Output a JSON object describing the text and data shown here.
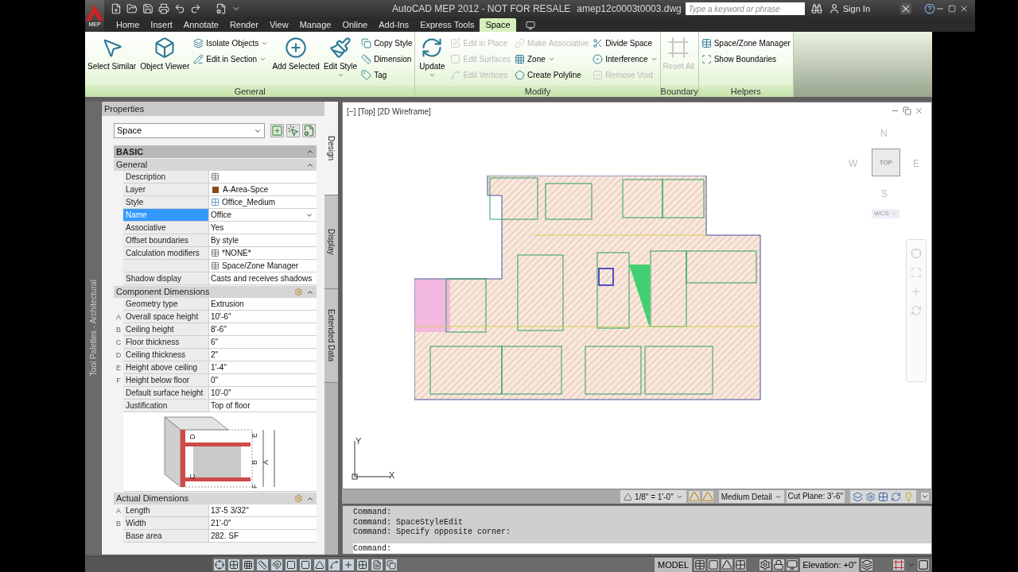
{
  "app_button": {
    "label": "MEP"
  },
  "title_bar": {
    "title": "AutoCAD MEP 2012 - NOT FOR RESALE",
    "filename": "amep12c0003t0003.dwg",
    "search_placeholder": "Type a keyword or phrase",
    "sign_in": "Sign In"
  },
  "ribbon_tabs": [
    {
      "label": "Home",
      "selected": false
    },
    {
      "label": "Insert",
      "selected": false
    },
    {
      "label": "Annotate",
      "selected": false
    },
    {
      "label": "Render",
      "selected": false
    },
    {
      "label": "View",
      "selected": false
    },
    {
      "label": "Manage",
      "selected": false
    },
    {
      "label": "Online",
      "selected": false
    },
    {
      "label": "Add-Ins",
      "selected": false
    },
    {
      "label": "Express Tools",
      "selected": false
    },
    {
      "label": "Space",
      "selected": true
    }
  ],
  "ribbon_panels": [
    {
      "title": "General",
      "groups": [
        {
          "kind": "large",
          "label": "Select Similar",
          "disabled": false,
          "dropdown": false
        },
        {
          "kind": "large",
          "label": "Object Viewer",
          "disabled": false,
          "dropdown": false
        },
        {
          "kind": "stack",
          "items": [
            {
              "label": "Isolate Objects",
              "disabled": false,
              "dropdown": true
            },
            {
              "label": "Edit in Section",
              "disabled": false,
              "dropdown": true
            }
          ]
        },
        {
          "kind": "large",
          "label": "Add Selected",
          "disabled": false,
          "dropdown": false
        },
        {
          "kind": "large",
          "label": "Edit Style",
          "disabled": false,
          "dropdown": true
        },
        {
          "kind": "stack",
          "items": [
            {
              "label": "Copy Style",
              "disabled": false,
              "dropdown": false
            },
            {
              "label": "Dimension",
              "disabled": false,
              "dropdown": false
            },
            {
              "label": "Tag",
              "disabled": false,
              "dropdown": false
            }
          ]
        }
      ]
    },
    {
      "title": "Modify",
      "groups": [
        {
          "kind": "large",
          "label": "Update",
          "disabled": false,
          "dropdown": true
        },
        {
          "kind": "stack",
          "items": [
            {
              "label": "Edit in Place",
              "disabled": true,
              "dropdown": false
            },
            {
              "label": "Edit Surfaces",
              "disabled": true,
              "dropdown": false
            },
            {
              "label": "Edit Vertices",
              "disabled": true,
              "dropdown": false
            }
          ]
        },
        {
          "kind": "stack",
          "items": [
            {
              "label": "Make Associative",
              "disabled": true,
              "dropdown": false
            },
            {
              "label": "Zone",
              "disabled": false,
              "dropdown": true
            },
            {
              "label": "Create Polyline",
              "disabled": false,
              "dropdown": false
            }
          ]
        },
        {
          "kind": "stack",
          "items": [
            {
              "label": "Divide Space",
              "disabled": false,
              "dropdown": false
            },
            {
              "label": "Interference",
              "disabled": false,
              "dropdown": true
            },
            {
              "label": "Remove Void",
              "disabled": true,
              "dropdown": false
            }
          ]
        }
      ]
    },
    {
      "title": "Boundary",
      "groups": [
        {
          "kind": "large",
          "label": "Reset All",
          "disabled": true,
          "dropdown": false
        }
      ]
    },
    {
      "title": "Helpers",
      "groups": [
        {
          "kind": "stack",
          "items": [
            {
              "label": "Space/Zone Manager",
              "disabled": false,
              "dropdown": false
            },
            {
              "label": "Show Boundaries",
              "disabled": false,
              "dropdown": false
            }
          ]
        }
      ]
    }
  ],
  "tool_palettes": {
    "label": "Tool Palettes - Architectural"
  },
  "properties": {
    "title": "Properties",
    "selector": "Space",
    "side_tabs": [
      {
        "label": "Design",
        "selected": true
      },
      {
        "label": "Display",
        "selected": false
      },
      {
        "label": "Extended Data",
        "selected": false
      }
    ],
    "sections": [
      {
        "title": "BASIC",
        "expanded": true,
        "categories": [
          {
            "title": "General",
            "expanded": true,
            "settings_button": false,
            "rows": [
              {
                "label": "Description",
                "kind": "icon",
                "selected": false
              },
              {
                "label": "Layer",
                "value": "A-Area-Spce",
                "kind": "swatch",
                "selected": false
              },
              {
                "label": "Style",
                "value": "Office_Medium",
                "kind": "style",
                "selected": false
              },
              {
                "label": "Name",
                "value": "Office",
                "kind": "dropdown",
                "selected": true
              },
              {
                "label": "Associative",
                "value": "Yes",
                "kind": "plain",
                "selected": false
              },
              {
                "label": "Offset boundaries",
                "value": "By style",
                "kind": "plain",
                "selected": false
              },
              {
                "label": "Calculation modifiers",
                "value": "*NONE*",
                "kind": "icon",
                "selected": false
              },
              {
                "value": "Space/Zone Manager",
                "kind": "icon",
                "selected": false
              },
              {
                "label": "Shadow display",
                "value": "Casts and receives shadows",
                "kind": "plain",
                "selected": false
              }
            ]
          },
          {
            "title": "Component Dimensions",
            "expanded": true,
            "settings_button": true,
            "rows": [
              {
                "label": "Geometry type",
                "value": "Extrusion",
                "kind": "plain",
                "selected": false
              },
              {
                "marker": "A",
                "label": "Overall space height",
                "value": "10'-6\"",
                "kind": "plain",
                "selected": false
              },
              {
                "marker": "B",
                "label": "Ceiling height",
                "value": "8'-6\"",
                "kind": "plain",
                "selected": false
              },
              {
                "marker": "C",
                "label": "Floor thickness",
                "value": "6\"",
                "kind": "plain",
                "selected": false
              },
              {
                "marker": "D",
                "label": "Ceiling thickness",
                "value": "2\"",
                "kind": "plain",
                "selected": false
              },
              {
                "marker": "E",
                "label": "Height above ceiling",
                "value": "1'-4\"",
                "kind": "plain",
                "selected": false
              },
              {
                "marker": "F",
                "label": "Height below floor",
                "value": "0\"",
                "kind": "plain",
                "selected": false
              },
              {
                "label": "Default surface height",
                "value": "10'-0\"",
                "kind": "plain",
                "selected": false
              },
              {
                "label": "Justification",
                "value": "Top of floor",
                "kind": "plain",
                "selected": false
              }
            ],
            "diagram_labels": [
              "D",
              "C",
              "E",
              "B",
              "A",
              "F"
            ]
          },
          {
            "title": "Actual Dimensions",
            "expanded": true,
            "settings_button": true,
            "rows": [
              {
                "marker": "A",
                "label": "Length",
                "value": "13'-5 3/32\"",
                "kind": "plain",
                "selected": false
              },
              {
                "marker": "B",
                "label": "Width",
                "value": "21'-0\"",
                "kind": "plain",
                "selected": false
              },
              {
                "label": "Base area",
                "value": "282. SF",
                "kind": "plain",
                "selected": false
              }
            ]
          }
        ]
      }
    ]
  },
  "viewport": {
    "label": "[−] [Top] [2D Wireframe]",
    "viewcube": {
      "face": "TOP",
      "north": "N",
      "south": "S",
      "east": "E",
      "west": "W",
      "ucs": "WCS"
    },
    "ucs_icon": {
      "x": "X",
      "y": "Y"
    }
  },
  "viewport_status": {
    "scale": "1/8\" = 1'-0\"",
    "detail": "Medium Detail",
    "cut_plane": "Cut Plane: 3'-6\""
  },
  "command_line": {
    "history": [
      "Command:",
      "Command: SpaceStyleEdit",
      "Command: Specify opposite corner:"
    ],
    "prompt": "Command:"
  },
  "status_bar": {
    "model": "MODEL",
    "elevation": "Elevation: +0\""
  }
}
